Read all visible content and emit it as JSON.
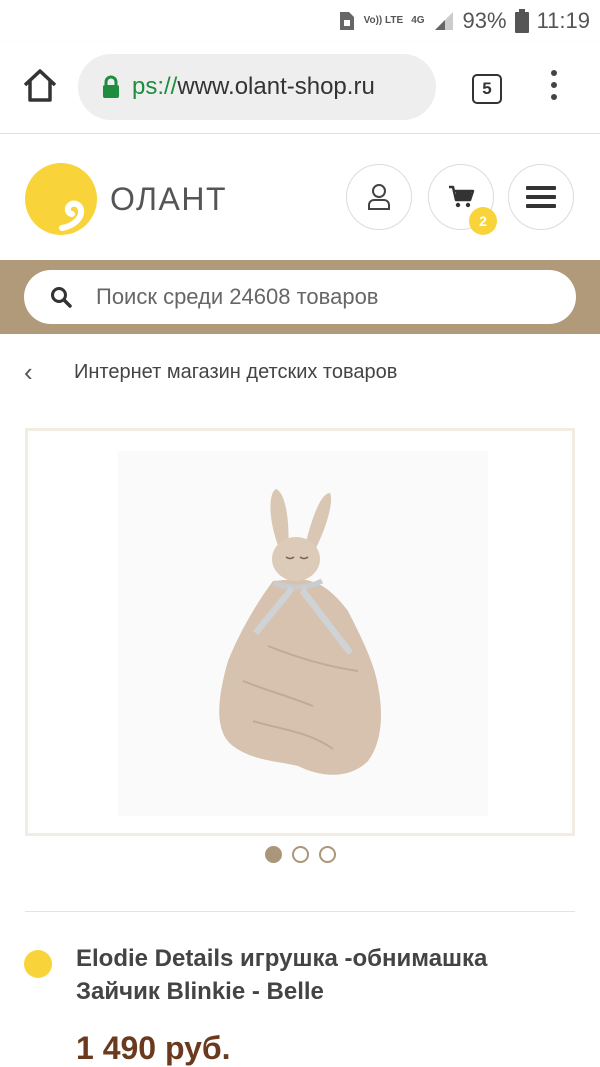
{
  "status_bar": {
    "volte": "Vo)) LTE",
    "network": "4G",
    "battery": "93%",
    "time": "11:19"
  },
  "browser": {
    "url_scheme": "ps://",
    "url_host": "www.olant-shop.ru",
    "tab_count": "5"
  },
  "site": {
    "logo_text": "ОЛАНТ",
    "cart_count": "2"
  },
  "search": {
    "placeholder": "Поиск среди 24608 товаров"
  },
  "breadcrumb": {
    "label": "Интернет магазин детских товаров"
  },
  "carousel": {
    "total": 3,
    "active_index": 0
  },
  "product": {
    "title": "Elodie Details игрушка -обнимашка Зайчик Blinkie - Belle",
    "price": "1 490 руб."
  },
  "colors": {
    "brand_yellow": "#f8d43a",
    "search_band": "#b09a7a",
    "price": "#6b3a1e",
    "dot": "#aa967a"
  }
}
